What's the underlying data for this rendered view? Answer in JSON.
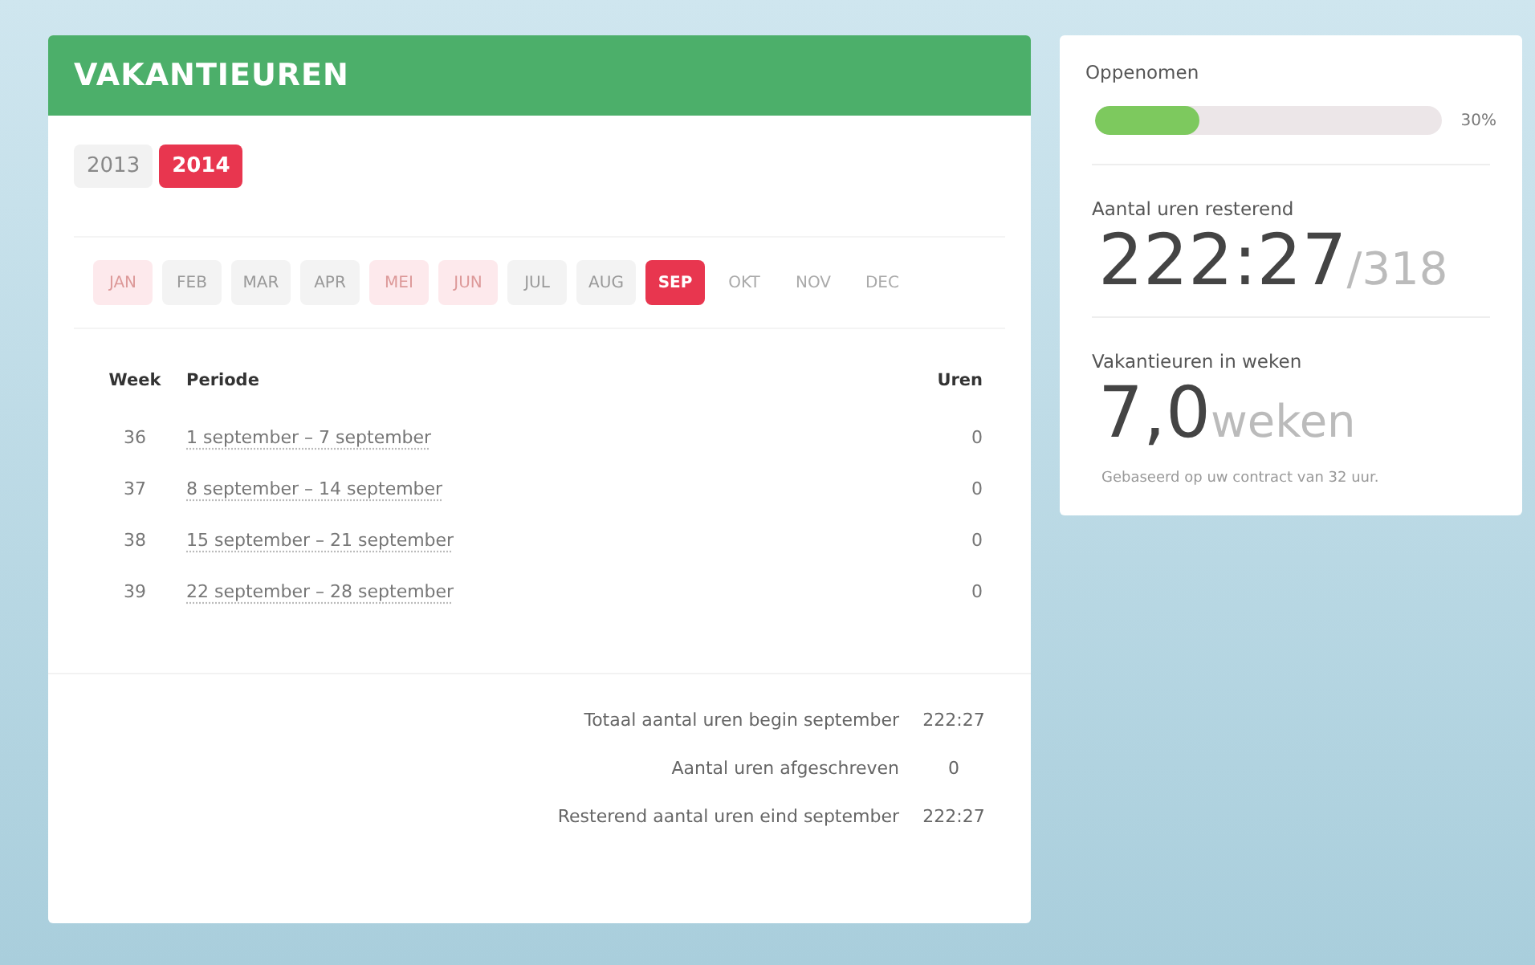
{
  "main": {
    "title": "VAKANTIEUREN",
    "years": [
      {
        "label": "2013",
        "selected": false
      },
      {
        "label": "2014",
        "selected": true
      }
    ],
    "months": [
      {
        "label": "JAN",
        "selected": false,
        "disabled": false,
        "taken": true
      },
      {
        "label": "FEB",
        "selected": false,
        "disabled": false,
        "taken": false
      },
      {
        "label": "MAR",
        "selected": false,
        "disabled": false,
        "taken": false
      },
      {
        "label": "APR",
        "selected": false,
        "disabled": false,
        "taken": false
      },
      {
        "label": "MEI",
        "selected": false,
        "disabled": false,
        "taken": true
      },
      {
        "label": "JUN",
        "selected": false,
        "disabled": false,
        "taken": true
      },
      {
        "label": "JUL",
        "selected": false,
        "disabled": false,
        "taken": false
      },
      {
        "label": "AUG",
        "selected": false,
        "disabled": false,
        "taken": false
      },
      {
        "label": "SEP",
        "selected": true,
        "disabled": false,
        "taken": false
      },
      {
        "label": "OKT",
        "selected": false,
        "disabled": true,
        "taken": false
      },
      {
        "label": "NOV",
        "selected": false,
        "disabled": true,
        "taken": false
      },
      {
        "label": "DEC",
        "selected": false,
        "disabled": true,
        "taken": false
      }
    ],
    "table": {
      "columns": [
        "Week",
        "Periode",
        "Uren"
      ],
      "rows": [
        {
          "week": "36",
          "period": "1 september – 7 september",
          "hours": "0"
        },
        {
          "week": "37",
          "period": "8 september – 14 september",
          "hours": "0"
        },
        {
          "week": "38",
          "period": "15 september – 21 september",
          "hours": "0"
        },
        {
          "week": "39",
          "period": "22 september – 28 september",
          "hours": "0"
        }
      ]
    },
    "totals": [
      {
        "label": "Totaal aantal uren begin september",
        "value": "222:27"
      },
      {
        "label": "Aantal uren afgeschreven",
        "value": "0"
      },
      {
        "label": "Resterend aantal uren eind september",
        "value": "222:27"
      }
    ]
  },
  "side": {
    "taken": {
      "label": "Oppenomen",
      "level": 0.3,
      "reading": "30%"
    },
    "remaining": {
      "label": "Aantal uren resterend",
      "value": "222:27",
      "total": "/318"
    },
    "weeks": {
      "label": "Vakantieuren in weken",
      "value": "7,0",
      "unit": "weken",
      "note": "Gebaseerd op uw contract van 32 uur."
    }
  }
}
